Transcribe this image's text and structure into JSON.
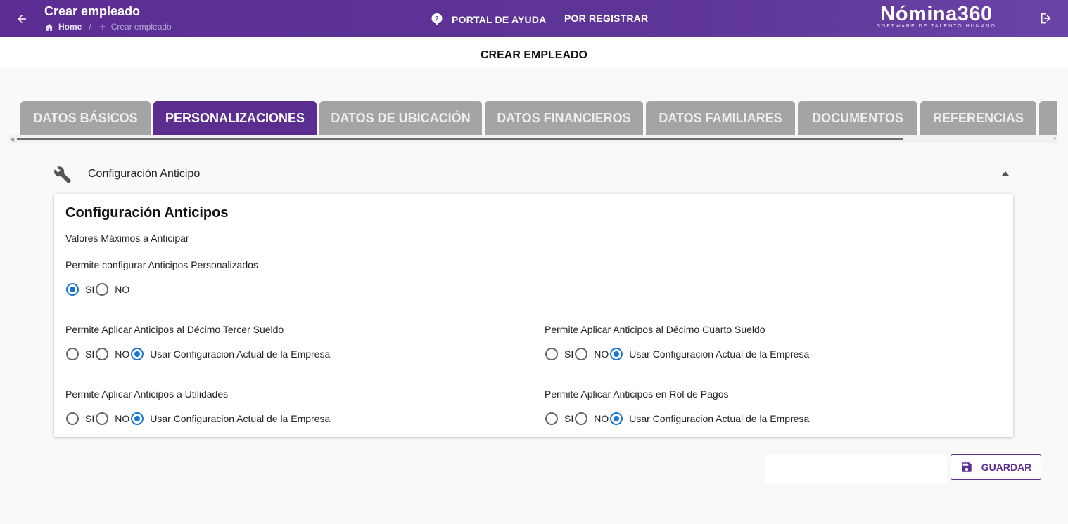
{
  "header": {
    "title": "Crear empleado",
    "breadcrumb": {
      "home": "Home",
      "separator": "/",
      "current": "Crear empleado"
    },
    "nav": {
      "help": "PORTAL DE AYUDA",
      "register": "POR REGISTRAR"
    },
    "logo": {
      "name": "Nómina360",
      "tagline": "SOFTWARE DE TALENTO HUMANO"
    },
    "icons": {
      "back": "arrow-left-icon",
      "home": "home-icon",
      "add": "plus-icon",
      "help": "help-pin-icon",
      "logout": "logout-icon"
    }
  },
  "page_title": "CREAR EMPLEADO",
  "tabs": [
    {
      "label": "DATOS BÁSICOS",
      "active": false
    },
    {
      "label": "PERSONALIZACIONES",
      "active": true
    },
    {
      "label": "DATOS DE UBICACIÓN",
      "active": false
    },
    {
      "label": "DATOS FINANCIEROS",
      "active": false
    },
    {
      "label": "DATOS FAMILIARES",
      "active": false
    },
    {
      "label": "DOCUMENTOS",
      "active": false
    },
    {
      "label": "REFERENCIAS",
      "active": false
    }
  ],
  "section": {
    "title": "Configuración Anticipo",
    "icon": "wrench-icon",
    "expanded": true
  },
  "card": {
    "title": "Configuración Anticipos",
    "subtitle": "Valores Máximos a Anticipar",
    "options": {
      "si": "SI",
      "no": "NO",
      "empresa": "Usar Configuracion Actual de la Empresa"
    },
    "questions": {
      "personalizados": {
        "label": "Permite configurar Anticipos Personalizados",
        "selected": "si"
      },
      "decimo_tercer": {
        "label": "Permite Aplicar Anticipos al Décimo Tercer Sueldo",
        "selected": "empresa"
      },
      "decimo_cuarto": {
        "label": "Permite Aplicar Anticipos al Décimo Cuarto Sueldo",
        "selected": "empresa"
      },
      "utilidades": {
        "label": "Permite Aplicar Anticipos a Utilidades",
        "selected": "empresa"
      },
      "rol_pagos": {
        "label": "Permite Aplicar Anticipos en Rol de Pagos",
        "selected": "empresa"
      }
    }
  },
  "actions": {
    "save": "GUARDAR",
    "save_icon": "floppy-disk-icon"
  },
  "colors": {
    "primary": "#5a2d8f",
    "tab_inactive": "#a4a4a4",
    "radio_checked": "#1976d2"
  }
}
